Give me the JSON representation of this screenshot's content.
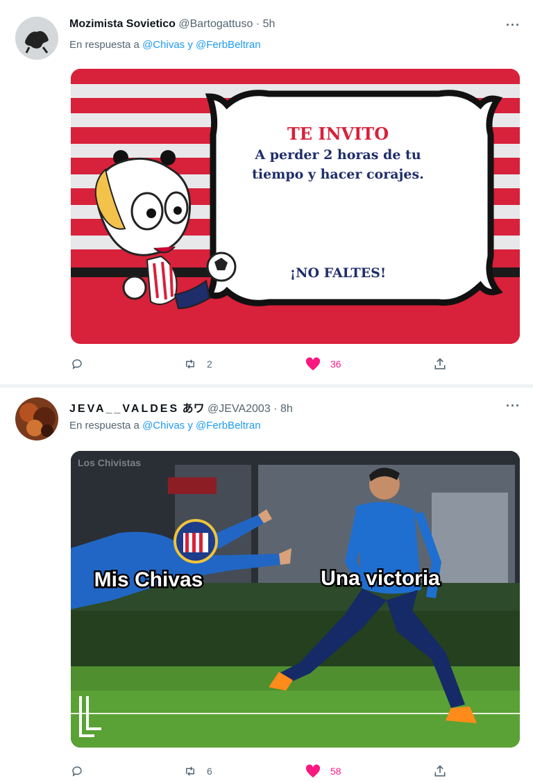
{
  "tweets": [
    {
      "name": "Mozimista Sovietico",
      "handle": "@Bartogattuso",
      "time": "· 5h",
      "more": "···",
      "reply_prefix": "En respuesta a",
      "mentions": "@Chivas y @FerbBeltran",
      "card": {
        "title": "TE INVITO",
        "line1": "A perder 2 horas de tu",
        "line2": "tiempo y hacer corajes.",
        "footer": "¡NO FALTES!"
      },
      "retweets": "2",
      "likes": "36",
      "liked": true
    },
    {
      "name": "JEVA__VALDES",
      "name_suffix": "あワ",
      "handle": "@JEVA2003",
      "time": "· 8h",
      "more": "···",
      "reply_prefix": "En respuesta a",
      "mentions": "@Chivas y @FerbBeltran",
      "meme": {
        "watermark": "Los Chivistas",
        "left_caption": "Mis Chivas",
        "right_caption": "Una victoria"
      },
      "retweets": "6",
      "likes": "58",
      "liked": true
    }
  ],
  "colors": {
    "like_active": "#f91880",
    "mention": "#1d9bf0",
    "muted": "#536471",
    "stripe_red": "#d8213a"
  },
  "icons": [
    "reply-icon",
    "retweet-icon",
    "heart-icon",
    "share-icon",
    "more-icon"
  ]
}
